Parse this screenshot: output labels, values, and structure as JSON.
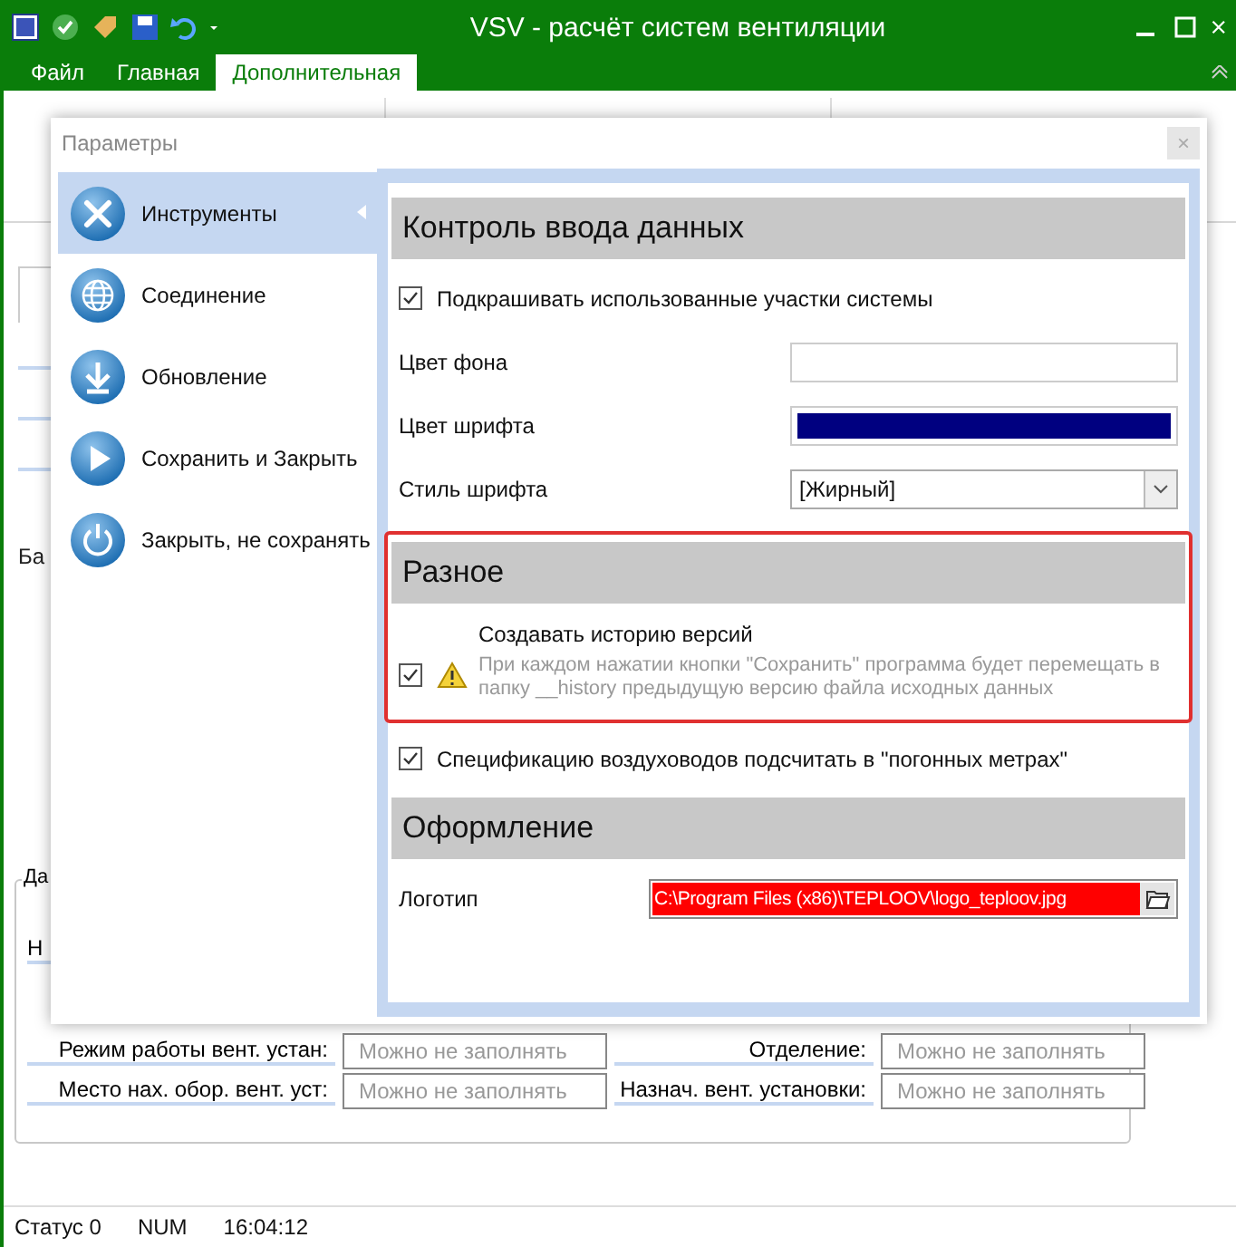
{
  "window": {
    "title": "VSV - расчёт систем вентиляции"
  },
  "ribbon_tabs": [
    {
      "label": "Файл",
      "selected": false
    },
    {
      "label": "Главная",
      "selected": false
    },
    {
      "label": "Дополнительная",
      "selected": true
    }
  ],
  "background_form": {
    "side_label": "Ба",
    "group_title": "Да",
    "group_first_label": "Н",
    "rows": [
      {
        "label": "Режим работы вент. устан:",
        "placeholder": "Можно не заполнять",
        "label_2": "Отделение:",
        "placeholder_2": "Можно не заполнять"
      },
      {
        "label": "Место  нах. обор. вент. уст:",
        "placeholder": "Можно не заполнять",
        "label_2": "Назнач. вент. установки:",
        "placeholder_2": "Можно не заполнять"
      }
    ]
  },
  "dialog": {
    "title": "Параметры",
    "close": "×",
    "nav": [
      {
        "label": "Инструменты",
        "selected": true
      },
      {
        "label": "Соединение",
        "selected": false
      },
      {
        "label": "Обновление",
        "selected": false
      },
      {
        "label": "Сохранить и Закрыть",
        "selected": false
      },
      {
        "label": "Закрыть, не сохранять",
        "selected": false
      }
    ],
    "blocks": [
      {
        "highlighted": false,
        "items": [
          {
            "kind": "header",
            "label": "Контроль ввода данных"
          },
          {
            "kind": "checkbox",
            "label": "Подкрашивать использованные участки системы",
            "checked": true
          },
          {
            "kind": "color",
            "label": "Цвет фона",
            "color": "#ffffff"
          },
          {
            "kind": "color",
            "label": "Цвет шрифта",
            "color": "#000080"
          },
          {
            "kind": "select",
            "label": "Стиль шрифта",
            "value": "[Жирный]"
          }
        ]
      },
      {
        "highlighted": true,
        "items": [
          {
            "kind": "header",
            "label": "Разное"
          },
          {
            "kind": "warning_checkbox",
            "label": "Создавать историю версий",
            "note": "При каждом нажатии кнопки \"Сохранить\"  программа будет перемещать в папку __history предыдущую версию файла исходных данных",
            "checked": true
          }
        ]
      },
      {
        "highlighted": false,
        "items": [
          {
            "kind": "checkbox",
            "label": "Спецификацию воздуховодов подсчитать в \"погонных метрах\"",
            "checked": true
          },
          {
            "kind": "header",
            "label": "Оформление"
          },
          {
            "kind": "file",
            "label": "Логотип",
            "value": "C:\\Program Files (x86)\\TEPLOOV\\logo_teploov.jpg"
          }
        ]
      }
    ]
  },
  "status_bar": [
    "Статус 0",
    "NUM",
    "16:04:12"
  ]
}
